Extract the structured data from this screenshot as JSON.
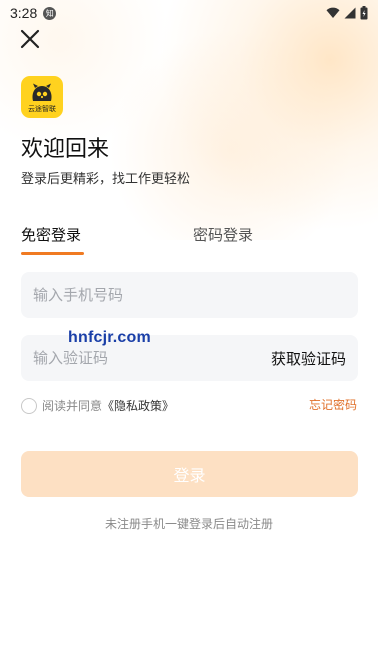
{
  "status_bar": {
    "time": "3:28",
    "notif_badge": "知"
  },
  "logo": {
    "text": "云途智联"
  },
  "header": {
    "title": "欢迎回来",
    "subtitle": "登录后更精彩，找工作更轻松"
  },
  "tabs": [
    {
      "label": "免密登录",
      "active": true
    },
    {
      "label": "密码登录",
      "active": false
    }
  ],
  "form": {
    "phone_placeholder": "输入手机号码",
    "code_placeholder": "输入验证码",
    "get_code_label": "获取验证码"
  },
  "watermark": "hnfcjr.com",
  "agreement": {
    "prefix": "阅读并同意",
    "policy": "《隐私政策》",
    "checked": false
  },
  "forgot_label": "忘记密码",
  "login_label": "登录",
  "note": "未注册手机一键登录后自动注册",
  "colors": {
    "accent": "#f07a22",
    "login_button": "#fde0c3",
    "logo_bg": "#ffd21f",
    "watermark": "#1a3fa8"
  }
}
